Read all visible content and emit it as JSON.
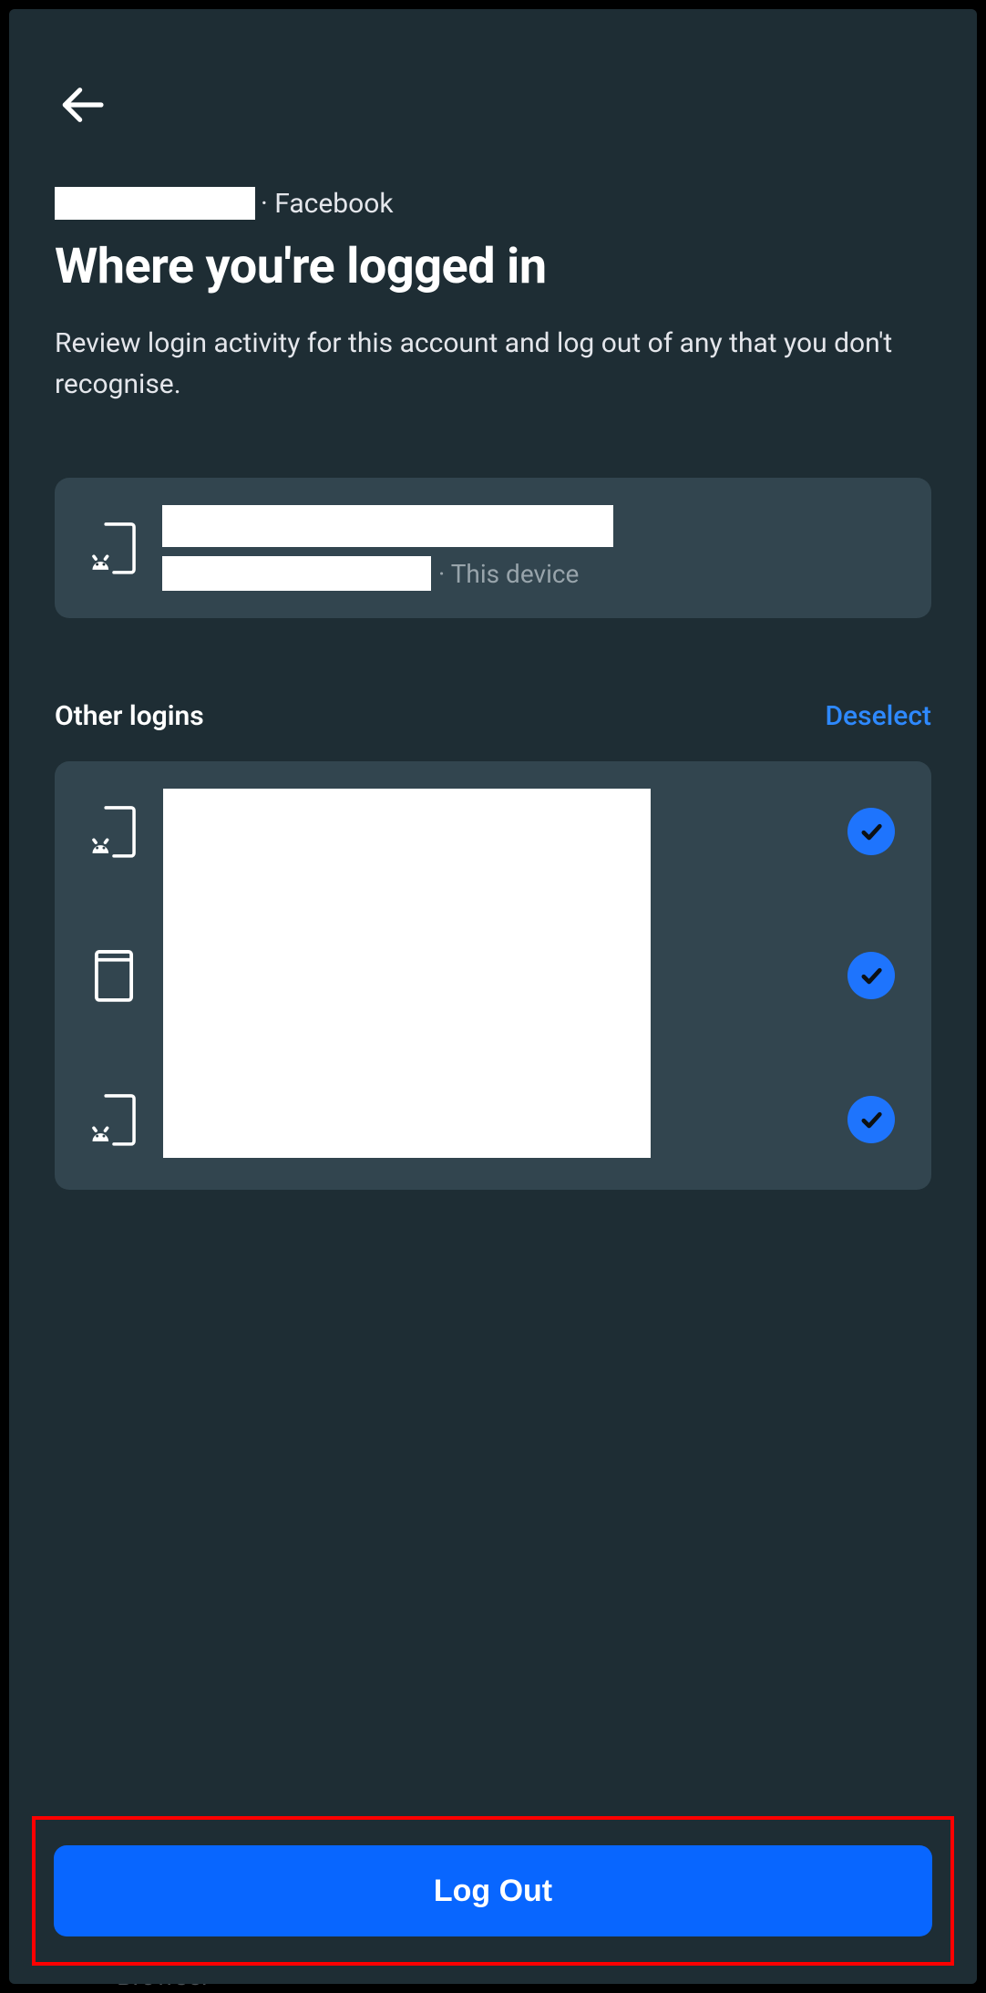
{
  "breadcrumb": {
    "platform": "Facebook"
  },
  "page": {
    "title": "Where you're logged in",
    "description": "Review login activity for this account and log out of any that you don't recognise."
  },
  "current_device": {
    "label_suffix": "· This device"
  },
  "other_logins": {
    "section_title": "Other logins",
    "deselect_label": "Deselect",
    "items": [
      {
        "icon": "android-device",
        "selected": true
      },
      {
        "icon": "tablet-device",
        "selected": true
      },
      {
        "icon": "android-device",
        "selected": true
      }
    ]
  },
  "footer": {
    "logout_label": "Log Out"
  },
  "obscured": {
    "tab": "Browser"
  },
  "colors": {
    "accent": "#1e74fd",
    "primary_button": "#0866ff",
    "card": "#32454f",
    "bg": "#1e2d34",
    "highlight_border": "#ff0000"
  }
}
